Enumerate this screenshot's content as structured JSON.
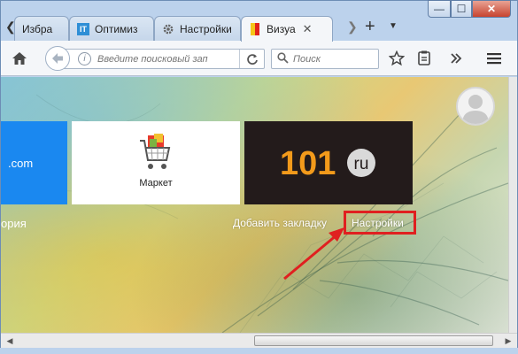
{
  "window": {
    "controls": {
      "minimize": "—",
      "maximize": "☐",
      "close": "✕"
    }
  },
  "tabs": [
    {
      "label": "Избра",
      "icon": "star-icon",
      "active": false
    },
    {
      "label": "Оптимиз",
      "icon": "it-logo-icon",
      "icon_text": "IT",
      "active": false
    },
    {
      "label": "Настройки",
      "icon": "gear-icon",
      "active": false
    },
    {
      "label": "Визуа",
      "icon": "yandex-bookmark-icon",
      "active": true,
      "close": "✕"
    }
  ],
  "tab_controls": {
    "scroll_left": "❮",
    "scroll_right": "❯",
    "new_tab": "+",
    "list_all": "▼"
  },
  "navbar": {
    "url_placeholder": "Введите поисковый зап",
    "search_placeholder": "Поиск"
  },
  "content": {
    "left_tile_text": ".com",
    "left_label": "ория",
    "market_label": "Маркет",
    "tile_101": {
      "digits": "101",
      "suffix": "ru"
    },
    "add_bookmark": "Добавить закладку",
    "settings": "Настройки"
  },
  "colors": {
    "highlight": "#e02020",
    "tile_blue": "#1a88f0",
    "tile_101_bg": "#231b1b",
    "tile_101_orange": "#f29a1b"
  }
}
